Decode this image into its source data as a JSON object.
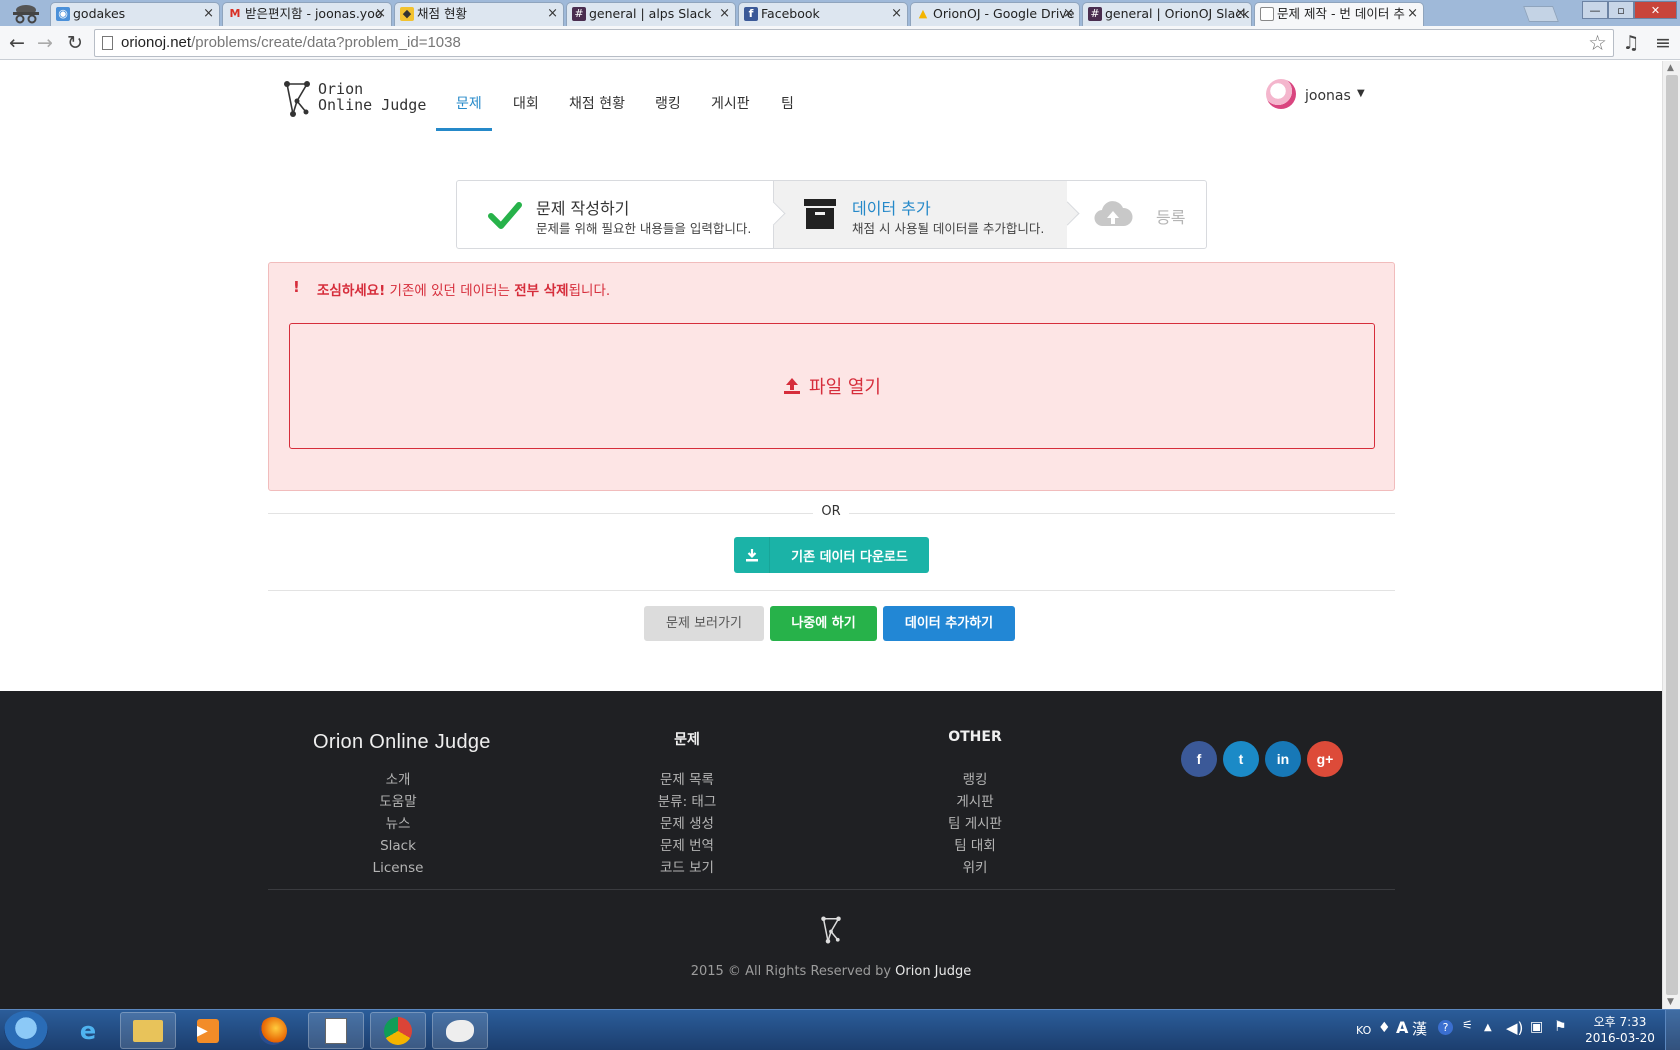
{
  "browser": {
    "tabs": [
      {
        "title": "godakes",
        "favicon": "tab-page-icon"
      },
      {
        "title": "받은편지함 - joonas.yoo",
        "favicon": "gmail-icon"
      },
      {
        "title": "채점 현황",
        "favicon": "orion-icon"
      },
      {
        "title": "general | alps Slack",
        "favicon": "slack-icon"
      },
      {
        "title": "Facebook",
        "favicon": "facebook-icon"
      },
      {
        "title": "OrionOJ - Google Drive",
        "favicon": "drive-icon"
      },
      {
        "title": "general | OrionOJ Slack",
        "favicon": "slack-icon"
      },
      {
        "title": "문제 제작 - 번 데이터 추",
        "favicon": "page-icon"
      }
    ],
    "url_host": "orionoj.net",
    "url_path": "/problems/create/data?problem_id=1038"
  },
  "nav": {
    "logo_line1": "Orion",
    "logo_line2": "Online Judge",
    "menu": [
      "문제",
      "대회",
      "채점 현황",
      "랭킹",
      "게시판",
      "팀"
    ],
    "active_index": 0,
    "username": "joonas",
    "accent_color": "#2589c9"
  },
  "steps": [
    {
      "title": "문제 작성하기",
      "desc": "문제를 위해 필요한 내용들을 입력합니다.",
      "state": "done",
      "icon": "check-icon"
    },
    {
      "title": "데이터 추가",
      "desc": "채점 시 사용될 데이터를 추가합니다.",
      "state": "current",
      "icon": "archive-box-icon"
    },
    {
      "title": "등록",
      "desc": "",
      "state": "pending",
      "icon": "cloud-upload-icon"
    }
  ],
  "alert": {
    "bang": "!",
    "strong": "조심하세요!",
    "text_before": " 기존에 있던 데이터는 ",
    "text_strong": "전부 삭제",
    "text_after": "됩니다.",
    "dropzone_label": "파일 열기",
    "color": "#d62d3b"
  },
  "divider_label": "OR",
  "download_button": "기존 데이터 다운로드",
  "actions": {
    "back": "문제 보러가기",
    "later": "나중에 하기",
    "add": "데이터 추가하기"
  },
  "footer": {
    "brand": "Orion Online Judge",
    "about_links": [
      "소개",
      "도움말",
      "뉴스",
      "Slack",
      "License"
    ],
    "problems_heading": "문제",
    "problems_links": [
      "문제 목록",
      "분류: 태그",
      "문제 생성",
      "문제 번역",
      "코드 보기"
    ],
    "other_heading": "OTHER",
    "other_links": [
      "랭킹",
      "게시판",
      "팀 게시판",
      "팀 대회",
      "위키"
    ],
    "social": [
      {
        "name": "facebook",
        "glyph": "f",
        "color": "#3b5998"
      },
      {
        "name": "twitter",
        "glyph": "t",
        "color": "#1b8ac7"
      },
      {
        "name": "linkedin",
        "glyph": "in",
        "color": "#1778b7"
      },
      {
        "name": "google-plus",
        "glyph": "g+",
        "color": "#dd4b39"
      }
    ],
    "copyright": "2015 © All Rights Reserved by ",
    "copyright_brand": "Orion Judge"
  },
  "taskbar": {
    "lang": "KO",
    "time": "오후 7:33",
    "date": "2016-03-20"
  }
}
